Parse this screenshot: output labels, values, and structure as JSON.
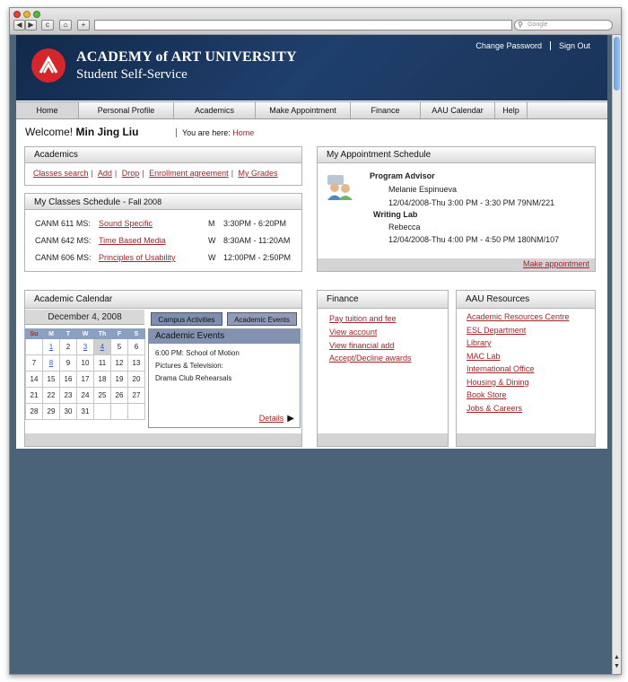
{
  "browser": {
    "search_placeholder": "Google",
    "back": "◀",
    "forward": "▶",
    "reload": "c",
    "home": "⌂",
    "add": "+"
  },
  "header": {
    "title": "ACADEMY of ART UNIVERSITY",
    "subtitle": "Student Self-Service",
    "change_password": "Change Password",
    "sign_out": "Sign Out"
  },
  "nav": {
    "items": [
      {
        "label": "Home"
      },
      {
        "label": "Personal Profile"
      },
      {
        "label": "Academics"
      },
      {
        "label": "Make Appointment"
      },
      {
        "label": "Finance"
      },
      {
        "label": "AAU Calendar"
      },
      {
        "label": "Help"
      }
    ]
  },
  "welcome": {
    "greeting": "Welcome!",
    "name": "Min Jing Liu",
    "you_are_here": "You are here:",
    "location": "Home"
  },
  "academics": {
    "title": "Academics",
    "links": [
      "Classes search",
      "Add",
      "Drop",
      "Enrollment agreement",
      "My Grades"
    ]
  },
  "schedule": {
    "title": "My Classes Schedule",
    "term": "Fall 2008",
    "classes": [
      {
        "code": "CANM  611 MS:",
        "name": "Sound Specific",
        "day": "M",
        "time": "3:30PM - 6:20PM"
      },
      {
        "code": "CANM  642 MS:",
        "name": "Time Based Media",
        "day": "W",
        "time": "8:30AM - 11:20AM"
      },
      {
        "code": "CANM  606 MS:",
        "name": "Principles of Usability",
        "day": "W",
        "time": "12:00PM - 2:50PM"
      }
    ]
  },
  "appointments": {
    "title": "My  Appointment Schedule",
    "items": [
      {
        "role": "Program Advisor",
        "person": "Melanie Espinueva",
        "when": "12/04/2008-Thu   3:00 PM - 3:30 PM  79NM/221"
      },
      {
        "role": "Writing Lab",
        "person": "Rebecca",
        "when": "12/04/2008-Thu   4:00 PM - 4:50 PM  180NM/107"
      }
    ],
    "make_link": "Make appointment"
  },
  "calendar": {
    "title": "Academic Calendar",
    "month": "December 4, 2008",
    "dow": [
      "Su",
      "M",
      "T",
      "W",
      "Th",
      "F",
      "S"
    ],
    "weeks": [
      [
        "",
        "1",
        "2",
        "3",
        "4",
        "5",
        "6"
      ],
      [
        "7",
        "8",
        "9",
        "10",
        "11",
        "12",
        "13"
      ],
      [
        "14",
        "15",
        "16",
        "17",
        "18",
        "19",
        "20"
      ],
      [
        "21",
        "22",
        "23",
        "24",
        "25",
        "26",
        "27"
      ],
      [
        "28",
        "29",
        "30",
        "31",
        "",
        "",
        ""
      ]
    ],
    "tab_campus": "Campus Activities",
    "tab_academic": "Academic Events",
    "events_title": "Academic Events",
    "event_lines": [
      "6:00 PM: School of Motion",
      "Pictures & Television:",
      "Drama Club Rehearsals"
    ],
    "details": "Details",
    "details_arrow": "▶"
  },
  "finance": {
    "title": "Finance",
    "links": [
      "Pay tuition and fee",
      "View account",
      "View financial add",
      "Accept/Decline awards"
    ]
  },
  "resources": {
    "title": "AAU Resources",
    "links": [
      "Academic Resources Centre",
      "ESL Department",
      "Library",
      "MAC Lab",
      "International Office",
      "Housing & Dining",
      "Book Store",
      "Jobs & Careers"
    ]
  }
}
